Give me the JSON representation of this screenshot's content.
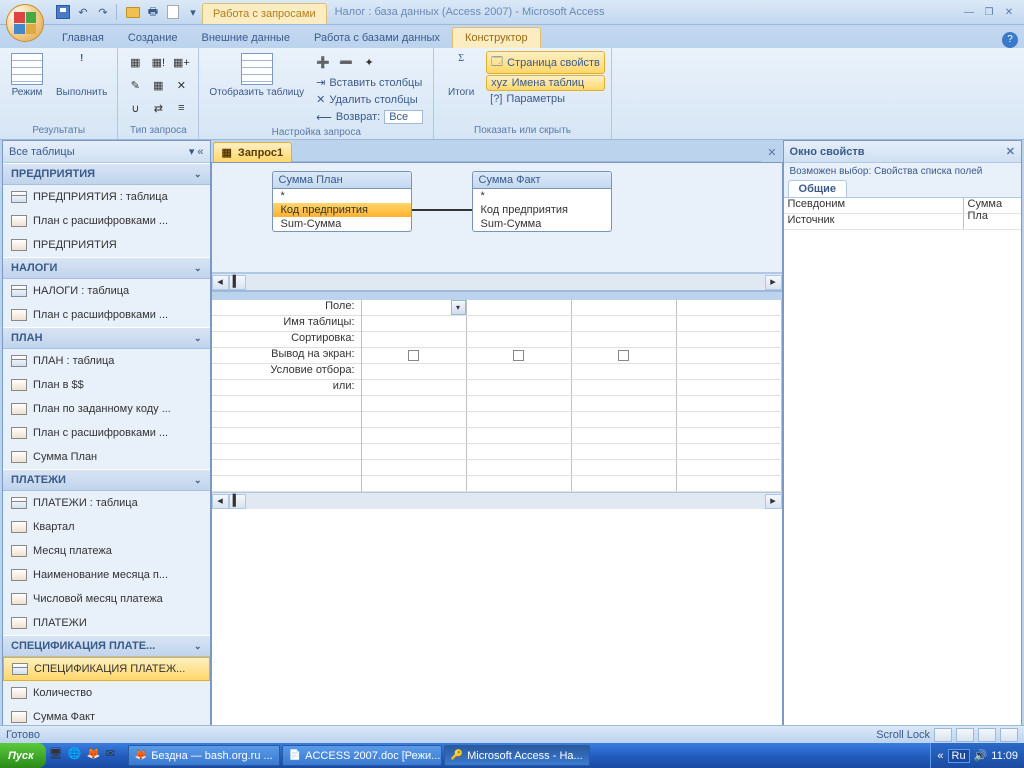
{
  "title": "Налог : база данных (Access 2007) - Microsoft Access",
  "context_tab": "Работа с запросами",
  "ribbon_tabs": [
    "Главная",
    "Создание",
    "Внешние данные",
    "Работа с базами данных",
    "Конструктор"
  ],
  "ribbon": {
    "results": {
      "mode": "Режим",
      "run": "Выполнить",
      "label": "Результаты"
    },
    "querytype": {
      "label": "Тип запроса"
    },
    "setup": {
      "showtable": "Отобразить таблицу",
      "insert_cols": "Вставить столбцы",
      "delete_cols": "Удалить столбцы",
      "return_lbl": "Возврат:",
      "return_val": "Все",
      "label": "Настройка запроса"
    },
    "totals": {
      "btn": "Итоги"
    },
    "showhide": {
      "prop_sheet": "Страница свойств",
      "table_names": "Имена таблиц",
      "params": "Параметры",
      "label": "Показать или скрыть"
    }
  },
  "nav": {
    "header": "Все таблицы",
    "groups": [
      {
        "title": "ПРЕДПРИЯТИЯ",
        "items": [
          {
            "t": "tbl",
            "n": "ПРЕДПРИЯТИЯ : таблица"
          },
          {
            "t": "qry",
            "n": "План с расшифровками ..."
          },
          {
            "t": "qry",
            "n": "ПРЕДПРИЯТИЯ"
          }
        ]
      },
      {
        "title": "НАЛОГИ",
        "items": [
          {
            "t": "tbl",
            "n": "НАЛОГИ : таблица"
          },
          {
            "t": "qry",
            "n": "План с расшифровками ..."
          }
        ]
      },
      {
        "title": "ПЛАН",
        "items": [
          {
            "t": "tbl",
            "n": "ПЛАН : таблица"
          },
          {
            "t": "qry",
            "n": "План в $$"
          },
          {
            "t": "qry",
            "n": "План по заданному коду ..."
          },
          {
            "t": "qry",
            "n": "План с расшифровками ..."
          },
          {
            "t": "qry",
            "n": "Сумма План"
          }
        ]
      },
      {
        "title": "ПЛАТЕЖИ",
        "items": [
          {
            "t": "tbl",
            "n": "ПЛАТЕЖИ : таблица"
          },
          {
            "t": "qry",
            "n": "Квартал"
          },
          {
            "t": "qry",
            "n": "Месяц платежа"
          },
          {
            "t": "qry",
            "n": "Наименование месяца п..."
          },
          {
            "t": "qry",
            "n": "Числовой месяц платежа"
          },
          {
            "t": "qry",
            "n": "ПЛАТЕЖИ"
          }
        ]
      },
      {
        "title": "СПЕЦИФИКАЦИЯ ПЛАТЕ...",
        "items": [
          {
            "t": "tbl",
            "n": "СПЕЦИФИКАЦИЯ ПЛАТЕЖ...",
            "sel": true
          },
          {
            "t": "qry",
            "n": "Количество"
          },
          {
            "t": "qry",
            "n": "Сумма Факт"
          }
        ]
      }
    ]
  },
  "doc": {
    "tab": "Запрос1",
    "tables": [
      {
        "name": "Сумма План",
        "fields": [
          "*",
          "Код предприятия",
          "Sum-Сумма"
        ],
        "sel": 1
      },
      {
        "name": "Сумма Факт",
        "fields": [
          "*",
          "Код предприятия",
          "Sum-Сумма"
        ]
      }
    ],
    "qbe_labels": [
      "Поле:",
      "Имя таблицы:",
      "Сортировка:",
      "Вывод на экран:",
      "Условие отбора:",
      "или:"
    ]
  },
  "props": {
    "title": "Окно свойств",
    "subtitle": "Возможен выбор:  Свойства списка полей",
    "tab": "Общие",
    "rows": [
      {
        "name": "Псевдоним",
        "val": "Сумма Пла"
      },
      {
        "name": "Источник",
        "val": ""
      }
    ]
  },
  "status": {
    "left": "Готово",
    "scroll_lock": "Scroll Lock"
  },
  "taskbar": {
    "start": "Пуск",
    "items": [
      "Бездна — bash.org.ru ...",
      "ACCESS 2007.doc [Режи...",
      "Microsoft Access - На..."
    ],
    "lang": "Ru",
    "time": "11:09"
  }
}
